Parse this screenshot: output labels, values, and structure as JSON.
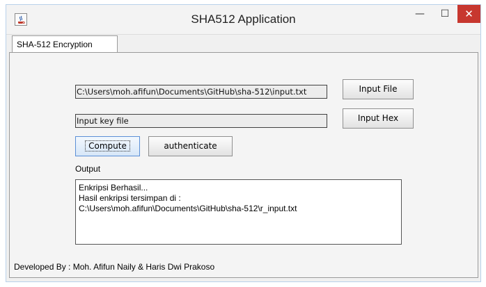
{
  "window": {
    "title": "SHA512 Application",
    "minimize_label": "—",
    "maximize_label": "☐",
    "close_label": "✕",
    "close_color": "#c7372f"
  },
  "tabs": [
    {
      "label": "SHA-512 Encryption",
      "selected": true
    }
  ],
  "form": {
    "input_file_path": "C:\\Users\\moh.afifun\\Documents\\GitHub\\sha-512\\input.txt",
    "input_file_button": "Input File",
    "key_field": "Input key file",
    "input_hex_button": "Input Hex",
    "compute_button": "Compute",
    "authenticate_button": "authenticate"
  },
  "output": {
    "label": "Output",
    "lines": [
      "Enkripsi Berhasil...",
      "Hasil enkripsi tersimpan di :",
      "C:\\Users\\moh.afifun\\Documents\\GitHub\\sha-512\\r_input.txt"
    ]
  },
  "footer": {
    "text": "Developed By : Moh. Afifun Naily & Haris Dwi Prakoso"
  },
  "icons": {
    "app": "java-coffee-icon"
  }
}
